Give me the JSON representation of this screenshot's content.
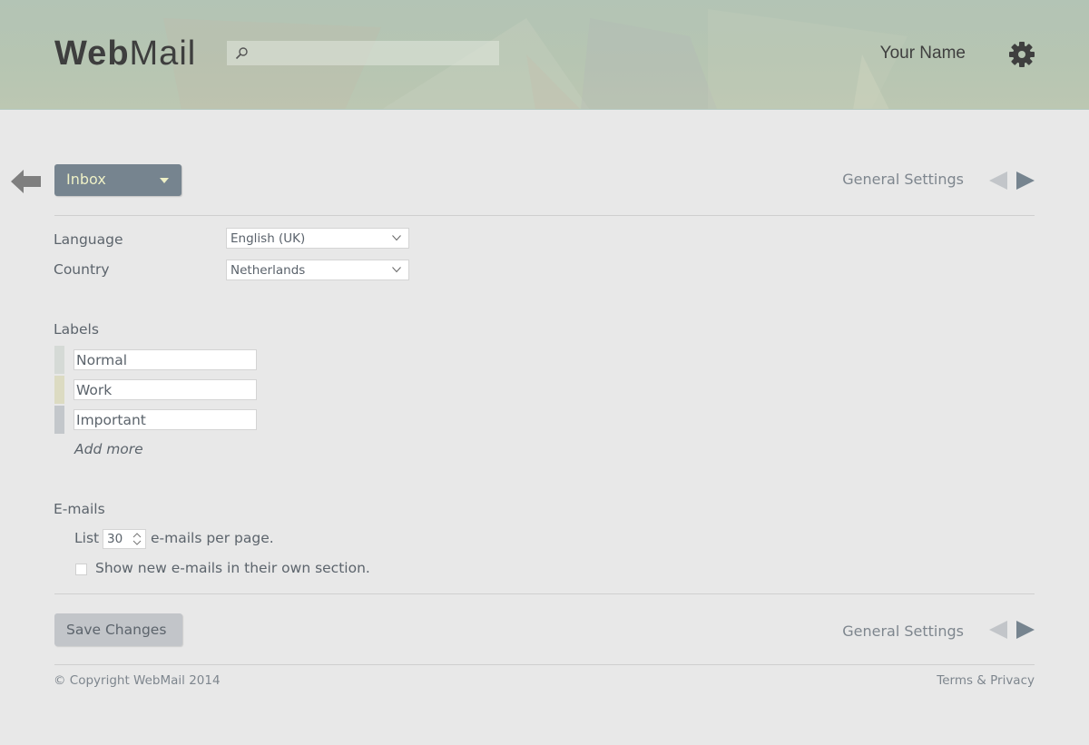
{
  "header": {
    "logo_bold": "Web",
    "logo_light": "Mail",
    "search": {
      "placeholder": "",
      "value": "",
      "icon": "search-icon"
    },
    "user_name": "Your Name",
    "settings_icon": "gear-icon"
  },
  "toolbar": {
    "back_icon": "arrow-left-icon",
    "folder": {
      "selected": "Inbox",
      "icon": "caret-down-icon"
    },
    "nav_title": "General Settings",
    "prev_icon": "triangle-left-icon",
    "next_icon": "triangle-right-icon"
  },
  "settings": {
    "language": {
      "label": "Language",
      "selected": "English (UK)"
    },
    "country": {
      "label": "Country",
      "selected": "Netherlands"
    },
    "labels": {
      "title": "Labels",
      "items": [
        {
          "name": "Normal",
          "color": "#d5dad6"
        },
        {
          "name": "Work",
          "color": "#dcdbc2"
        },
        {
          "name": "Important",
          "color": "#c3c7cb"
        }
      ],
      "add_more": "Add more"
    },
    "emails": {
      "title": "E-mails",
      "list_prefix": "List",
      "per_page": "30",
      "list_suffix": "e-mails per page.",
      "show_new_label": "Show new e-mails in their own section.",
      "show_new_checked": false
    }
  },
  "footer_nav": {
    "save_label": "Save Changes",
    "nav_title": "General Settings"
  },
  "footer": {
    "copyright": "© Copyright WebMail 2014",
    "terms": "Terms & Privacy"
  },
  "colors": {
    "folder_button": "#76848f",
    "folder_text": "#eef0c6",
    "save_button": "#c2c5c9",
    "page_bg": "#e8e8e8"
  }
}
